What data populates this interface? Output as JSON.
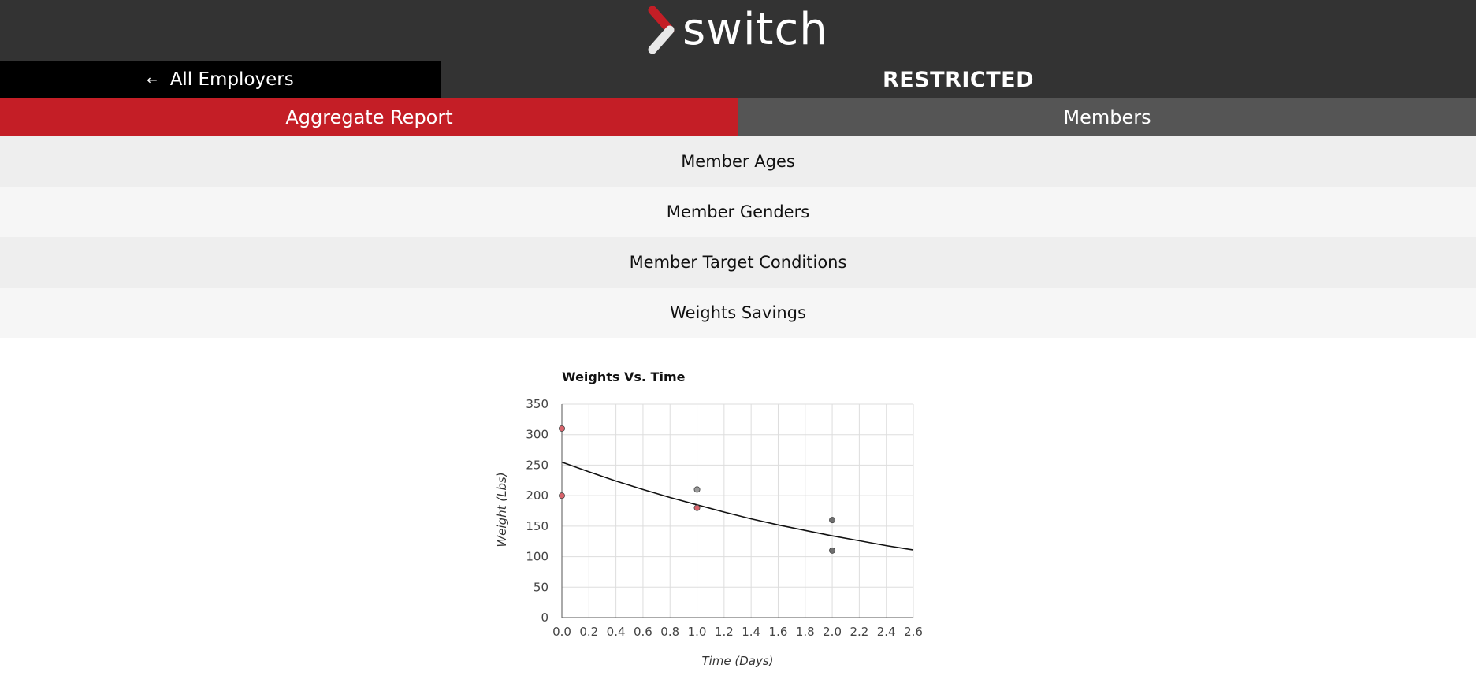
{
  "app": {
    "logo_text": "switch",
    "brand_color": "#c41e26"
  },
  "employer_bar": {
    "back_icon": "arrow-left-icon",
    "back_label": "All Employers",
    "employer_name": "RESTRICTED"
  },
  "tabs": [
    {
      "label": "Aggregate Report",
      "active": true
    },
    {
      "label": "Members",
      "active": false
    }
  ],
  "sections": [
    {
      "label": "Member Ages"
    },
    {
      "label": "Member Genders"
    },
    {
      "label": "Member Target Conditions"
    },
    {
      "label": "Weights Savings"
    }
  ],
  "chart_data": {
    "type": "scatter",
    "title": "Weights Vs. Time",
    "xlabel": "Time (Days)",
    "ylabel": "Weight (Lbs)",
    "xlim": [
      0,
      2.6
    ],
    "ylim": [
      0,
      350
    ],
    "xticks": [
      "0.0",
      "0.2",
      "0.4",
      "0.6",
      "0.8",
      "1.0",
      "1.2",
      "1.4",
      "1.6",
      "1.8",
      "2.0",
      "2.2",
      "2.4",
      "2.6"
    ],
    "yticks": [
      "0",
      "50",
      "100",
      "150",
      "200",
      "250",
      "300",
      "350"
    ],
    "grid": true,
    "points": [
      {
        "x": 0.0,
        "y": 310,
        "color": "#d9636b"
      },
      {
        "x": 0.0,
        "y": 200,
        "color": "#d9636b"
      },
      {
        "x": 1.0,
        "y": 210,
        "color": "#9a9a9a"
      },
      {
        "x": 1.0,
        "y": 180,
        "color": "#d9636b"
      },
      {
        "x": 2.0,
        "y": 160,
        "color": "#6e6e6e"
      },
      {
        "x": 2.0,
        "y": 110,
        "color": "#6e6e6e"
      }
    ],
    "trend": {
      "x": [
        0.0,
        0.2,
        0.4,
        0.6,
        0.8,
        1.0,
        1.2,
        1.4,
        1.6,
        1.8,
        2.0,
        2.2,
        2.4,
        2.6
      ],
      "y": [
        255,
        239,
        224,
        210,
        197,
        185,
        173,
        162,
        152,
        143,
        134,
        126,
        118,
        111
      ]
    }
  }
}
